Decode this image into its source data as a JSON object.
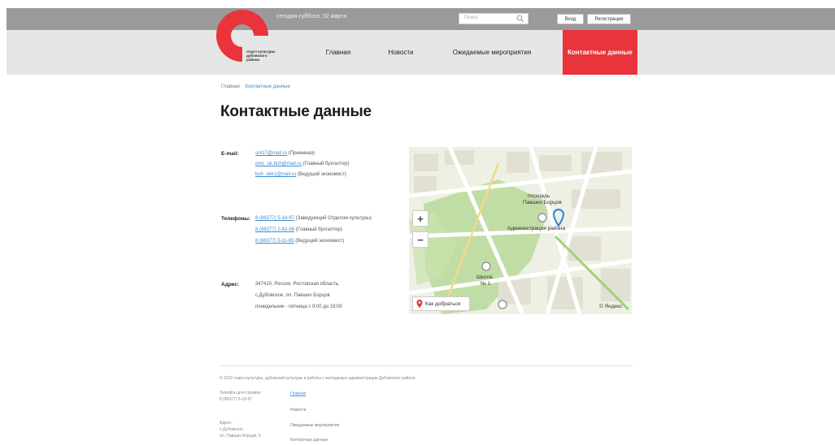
{
  "header": {
    "date_text": "сегодня суббота, 02 марта",
    "search_placeholder": "Поиск",
    "login_label": "Вход",
    "register_label": "Регистрация",
    "logo_text": "отдел культуры дубовского района",
    "brand_color": "#e8343a"
  },
  "nav": {
    "items": [
      {
        "label": "Главная"
      },
      {
        "label": "Новости"
      },
      {
        "label": "Ожидаемые мероприятия"
      },
      {
        "label": "Контактные данные",
        "active": true
      }
    ]
  },
  "breadcrumb": {
    "home": "Главная",
    "current": "Контактные данные"
  },
  "page": {
    "title": "Контактные данные"
  },
  "contacts": {
    "email_label": "E-mail:",
    "emails": [
      {
        "address": "sr417@mail.ru",
        "role": "(Приемная)"
      },
      {
        "address": "omc_uk.buh@mail.ru",
        "role": "(Главный бухгалтер)"
      },
      {
        "address": "buh_okk1@mail.ru",
        "role": "(Ведущий экономист)"
      }
    ],
    "phone_label": "Телефоны:",
    "phones": [
      {
        "number": "8 (86377) 5-19-97",
        "role": "(Заведующий Отделом культуры)"
      },
      {
        "number": "8 (86377) 2-82-98",
        "role": "(Главный бухгалтер)"
      },
      {
        "number": "8 (86377) 5-11-65",
        "role": "(Ведущий экономист)"
      }
    ],
    "address_label": "Адрес:",
    "address_lines": [
      "347410, Россия, Ростовская область,",
      "с.Дубовское, пл. Павших Борцов",
      "понедельник - пятница с 9:00 до 18:00"
    ]
  },
  "map": {
    "zoom_in": "+",
    "zoom_out": "−",
    "square_label_1": "площадь",
    "square_label_2": "Павших Борцов",
    "admin_label": "Администрация района",
    "school_label_1": "Школа",
    "school_label_2": "№ 1",
    "route_label": "Как добраться",
    "copyright": "© Яндекс",
    "park_color": "#b9d99b",
    "pin_color": "#2a86d8"
  },
  "footer": {
    "copyright": "© 2019 отдел культуры, дубовский культуры и работы с молодежью администрации Дубовского района",
    "phone_caption": "Телефон для справок:",
    "phone_value": "8 (86377) 5-19-97",
    "address_caption": "Адрес:",
    "address_line_1": "с.Дубовское,",
    "address_line_2": "пл. Павших Борцов, 5",
    "links": [
      "Главная",
      "Новости",
      "Ожидаемые мероприятия",
      "Контактные данные"
    ]
  }
}
